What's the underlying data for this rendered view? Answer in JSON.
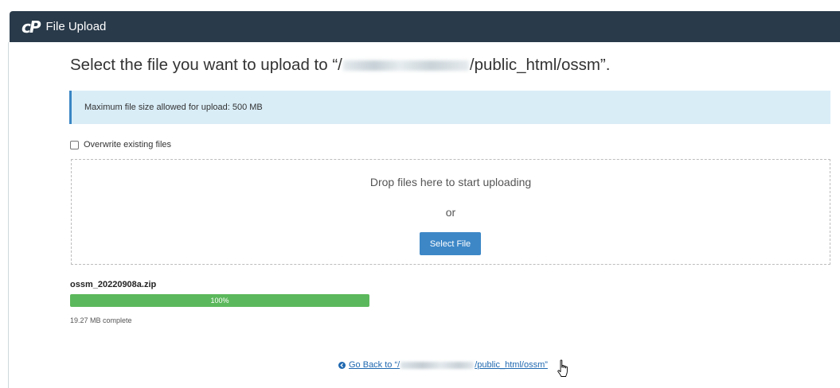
{
  "header": {
    "logo_text": "cP",
    "title": "File Upload"
  },
  "page": {
    "title_prefix": "Select the file you want to upload to “/",
    "title_suffix": "/public_html/ossm”."
  },
  "alert": {
    "text": "Maximum file size allowed for upload: 500 MB"
  },
  "overwrite": {
    "label": "Overwrite existing files",
    "checked": false
  },
  "dropzone": {
    "text": "Drop files here to start uploading",
    "or": "or",
    "button": "Select File"
  },
  "upload": {
    "filename": "ossm_20220908a.zip",
    "progress_text": "100%",
    "progress_percent": 100,
    "status": "19.27 MB complete"
  },
  "goback": {
    "prefix": "Go Back to “/",
    "suffix": "/public_html/ossm”"
  },
  "colors": {
    "header_bg": "#293a4a",
    "alert_bg": "#d9edf7",
    "alert_border": "#3a86c4",
    "button_bg": "#3d87c7",
    "progress_fill": "#5cb85c",
    "link": "#1f68b0"
  },
  "icons": {
    "back": "circle-arrow-left-icon",
    "cursor": "hand-pointer-icon"
  }
}
